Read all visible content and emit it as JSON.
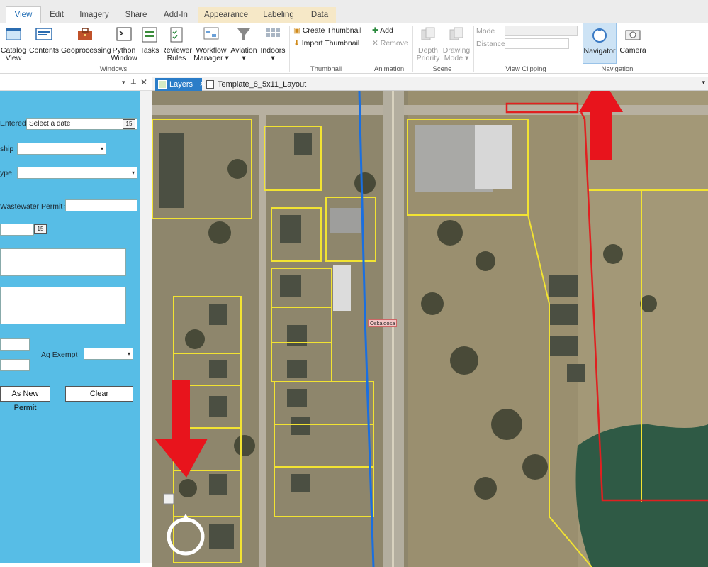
{
  "tabs": [
    "View",
    "Edit",
    "Imagery",
    "Share",
    "Add-In",
    "Appearance",
    "Labeling",
    "Data"
  ],
  "ribbon": {
    "buttons": [
      {
        "label": "Catalog\nView",
        "icon": "catalog-view-icon"
      },
      {
        "label": "Contents",
        "icon": "contents-icon"
      },
      {
        "label": "Geoprocessing",
        "icon": "toolbox-icon"
      },
      {
        "label": "Python\nWindow",
        "icon": "python-window-icon"
      },
      {
        "label": "Tasks",
        "icon": "tasks-icon"
      },
      {
        "label": "Reviewer\nRules",
        "icon": "reviewer-rules-icon"
      },
      {
        "label": "Workflow\nManager",
        "icon": "workflow-manager-icon"
      },
      {
        "label": "Aviation",
        "icon": "aviation-icon"
      },
      {
        "label": "Indoors",
        "icon": "indoors-icon"
      }
    ],
    "thumbnail": {
      "create": "Create Thumbnail",
      "import": "Import Thumbnail"
    },
    "animation": {
      "add": "Add",
      "remove": "Remove"
    },
    "scene": {
      "depth": "Depth\nPriority",
      "drawing": "Drawing\nMode"
    },
    "view_clipping": {
      "mode": "Mode",
      "distance": "Distance"
    },
    "navigation": {
      "navigator": "Navigator",
      "camera": "Camera"
    },
    "groups": {
      "windows": "Windows",
      "thumbnail": "Thumbnail",
      "animation": "Animation",
      "scene": "Scene",
      "view_clipping": "View Clipping",
      "navigation": "Navigation"
    }
  },
  "pane": {
    "labels": {
      "entered": "Entered",
      "township": "ship",
      "type": "ype",
      "wastewater": "Wastewater Permit #",
      "ag_exempt": "Ag Exempt"
    },
    "date_placeholder": "Select a date",
    "cal_glyph": "15",
    "buttons": {
      "save_new": "As New Permit",
      "clear": "Clear"
    }
  },
  "view_tabs": {
    "layers": "Layers",
    "layout": "Template_8_5x11_Layout"
  },
  "map": {
    "road_label": "Oskaloosa"
  },
  "colors": {
    "form_bg": "#57bde6",
    "parcel": "#f2e332",
    "highlight": "#e02020",
    "route": "#1a6fe0",
    "arrow": "#e8141c"
  }
}
